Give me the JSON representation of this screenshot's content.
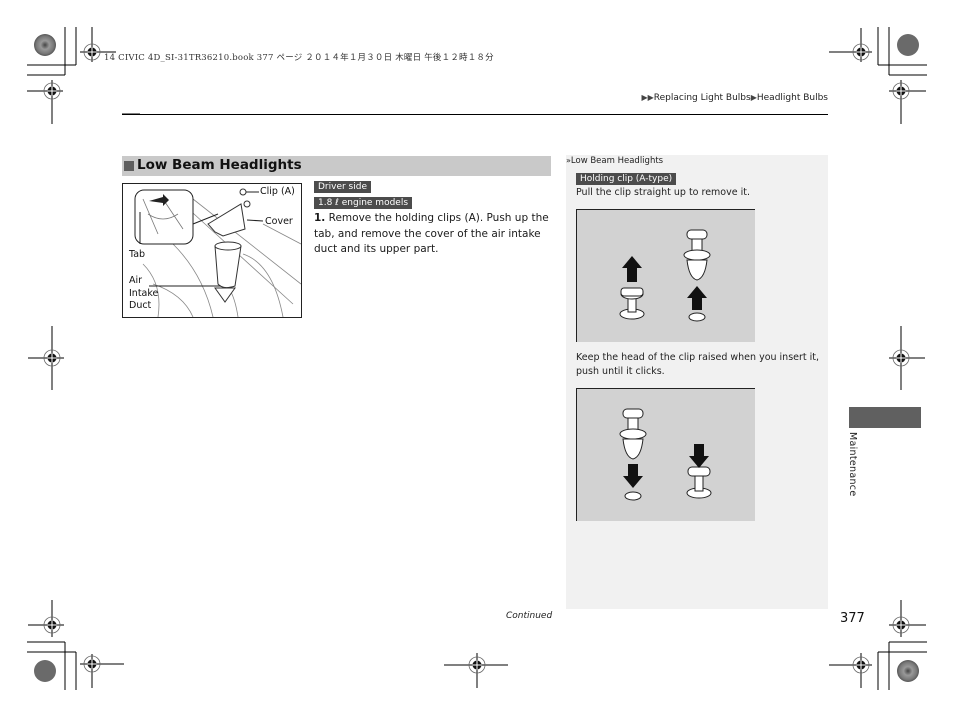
{
  "print_header": "14 CIVIC 4D_SI-31TR36210.book  377 ページ  ２０１４年１月３０日  木曜日  午後１２時１８分",
  "breadcrumb": {
    "prefix_icon": "double-triangle-right-icon",
    "items": [
      "Replacing Light Bulbs",
      "Headlight Bulbs"
    ],
    "separator_icon": "triangle-right-icon"
  },
  "section": {
    "icon": "square-bullet-icon",
    "title": "Low Beam Headlights"
  },
  "figure_main": {
    "labels": {
      "clip": "Clip (A)",
      "cover": "Cover",
      "tab": "Tab",
      "air": "Air",
      "intake": "Intake",
      "duct": "Duct"
    }
  },
  "badges": {
    "driver_side": "Driver side",
    "engine": "1.8 ℓ engine models"
  },
  "step": {
    "number": "1.",
    "text": "Remove the holding clips (A). Push up the tab, and remove the cover of the air intake duct and its upper part."
  },
  "note": {
    "ref_icon": "double-chevron-right-icon",
    "title": "Low Beam Headlights",
    "clip_badge": "Holding clip (A-type)",
    "remove_text": "Pull the clip straight up to remove it.",
    "insert_text": "Keep the head of the clip raised when you insert it, push until it clicks."
  },
  "side_tab": {
    "label": "Maintenance",
    "color": "#606060"
  },
  "footer": {
    "continued": "Continued",
    "page_number": "377"
  },
  "colors": {
    "section_bar": "#c9c9c9",
    "badge_bg": "#4c4c4c",
    "note_panel": "#f1f1f1",
    "figure_bg": "#d2d2d2"
  }
}
